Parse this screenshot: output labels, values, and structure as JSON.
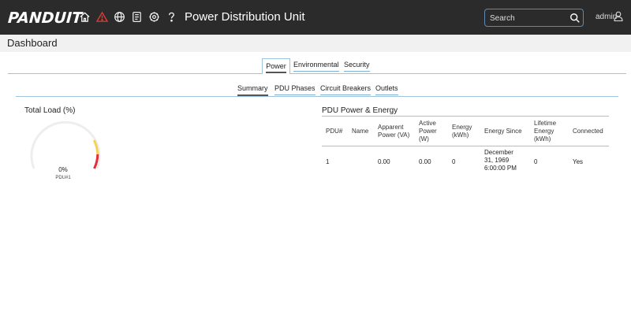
{
  "header": {
    "logo": "PANDUIT",
    "title": "Power Distribution Unit",
    "search_placeholder": "Search",
    "user": "admin",
    "alert_color": "#e53935"
  },
  "subheader": {
    "page_title": "Dashboard"
  },
  "main_tabs": [
    {
      "label": "Power",
      "active": true
    },
    {
      "label": "Environmental",
      "active": false
    },
    {
      "label": "Security",
      "active": false
    }
  ],
  "sub_tabs": [
    {
      "label": "Summary",
      "active": true
    },
    {
      "label": "PDU Phases",
      "active": false
    },
    {
      "label": "Circuit Breakers",
      "active": false
    },
    {
      "label": "Outlets",
      "active": false
    }
  ],
  "gauge": {
    "title": "Total Load (%)",
    "value": "0%",
    "label": "PDU#1",
    "load_fraction": 0
  },
  "table": {
    "title": "PDU Power & Energy",
    "columns": [
      [
        "PDU#"
      ],
      [
        "Name"
      ],
      [
        "Apparent",
        "Power (VA)"
      ],
      [
        "Active",
        "Power",
        "(W)"
      ],
      [
        "Energy",
        "(kWh)"
      ],
      [
        "Energy Since"
      ],
      [
        "Lifetime",
        "Energy",
        "(kWh)"
      ],
      [
        "Connected"
      ]
    ],
    "rows": [
      {
        "pdu": "1",
        "name": "",
        "apparent_power": "0.00",
        "active_power": "0.00",
        "energy": "0",
        "energy_since": [
          "December",
          "31, 1969",
          "6:00:00 PM"
        ],
        "lifetime_energy": "0",
        "connected": "Yes"
      }
    ]
  }
}
